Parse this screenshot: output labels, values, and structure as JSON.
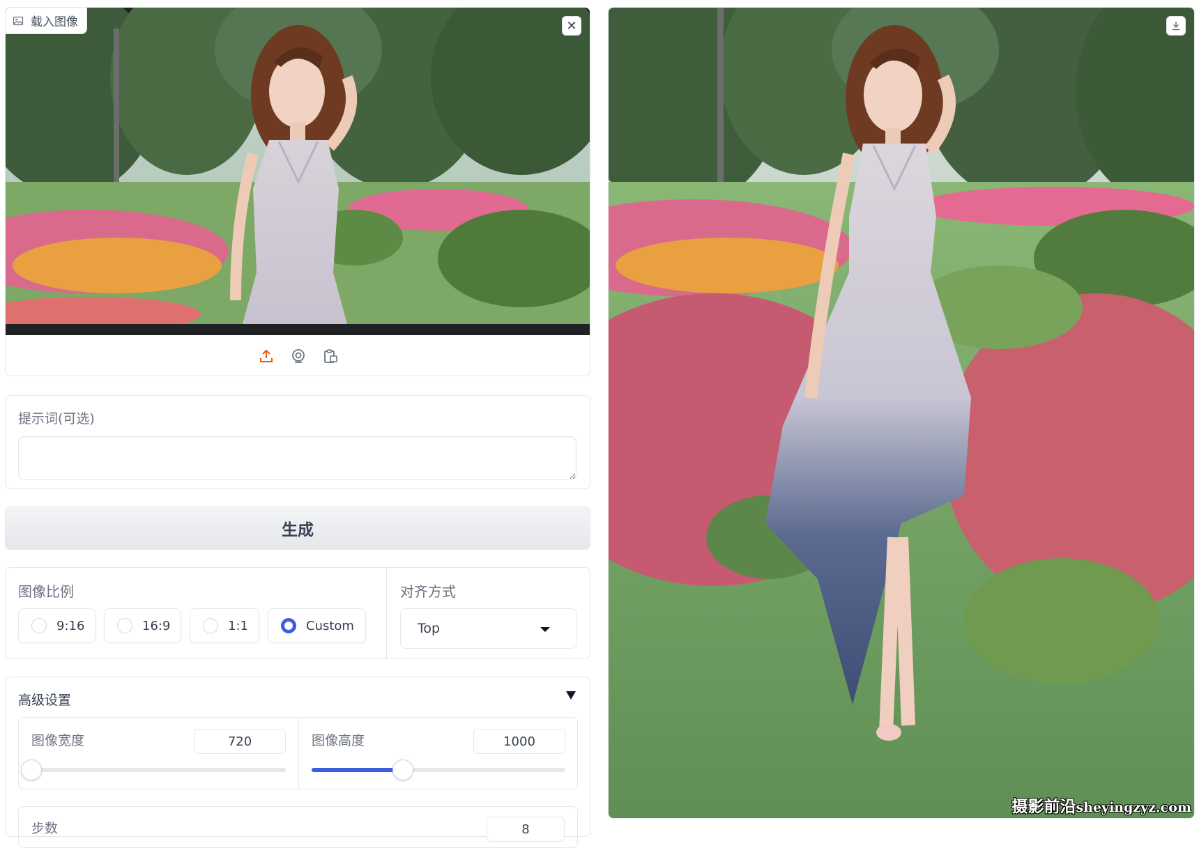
{
  "input_image": {
    "label": "载入图像",
    "label_icon": "image-icon",
    "close_icon": "close-icon",
    "sources": [
      {
        "icon": "upload-icon"
      },
      {
        "icon": "webcam-icon"
      },
      {
        "icon": "clipboard-icon"
      }
    ]
  },
  "prompt": {
    "label": "提示词(可选)",
    "value": "",
    "placeholder": ""
  },
  "generate_button": "生成",
  "aspect_ratio": {
    "label": "图像比例",
    "options": [
      "9:16",
      "16:9",
      "1:1",
      "Custom"
    ],
    "selected": "Custom"
  },
  "alignment": {
    "label": "对齐方式",
    "selected": "Top"
  },
  "advanced": {
    "title": "高级设置",
    "width": {
      "label": "图像宽度",
      "value": "720",
      "fraction": 0.0
    },
    "height": {
      "label": "图像高度",
      "value": "1000",
      "fraction": 0.36
    },
    "steps": {
      "label": "步数",
      "value": "8"
    }
  },
  "output_image": {
    "download_icon": "download-icon"
  },
  "watermark": {
    "text": "摄影前沿",
    "domain": "sheyingzyz.com"
  },
  "colors": {
    "accent": "#3b5ee0",
    "border": "#e5e7eb",
    "upload_icon": "#ea580c"
  }
}
